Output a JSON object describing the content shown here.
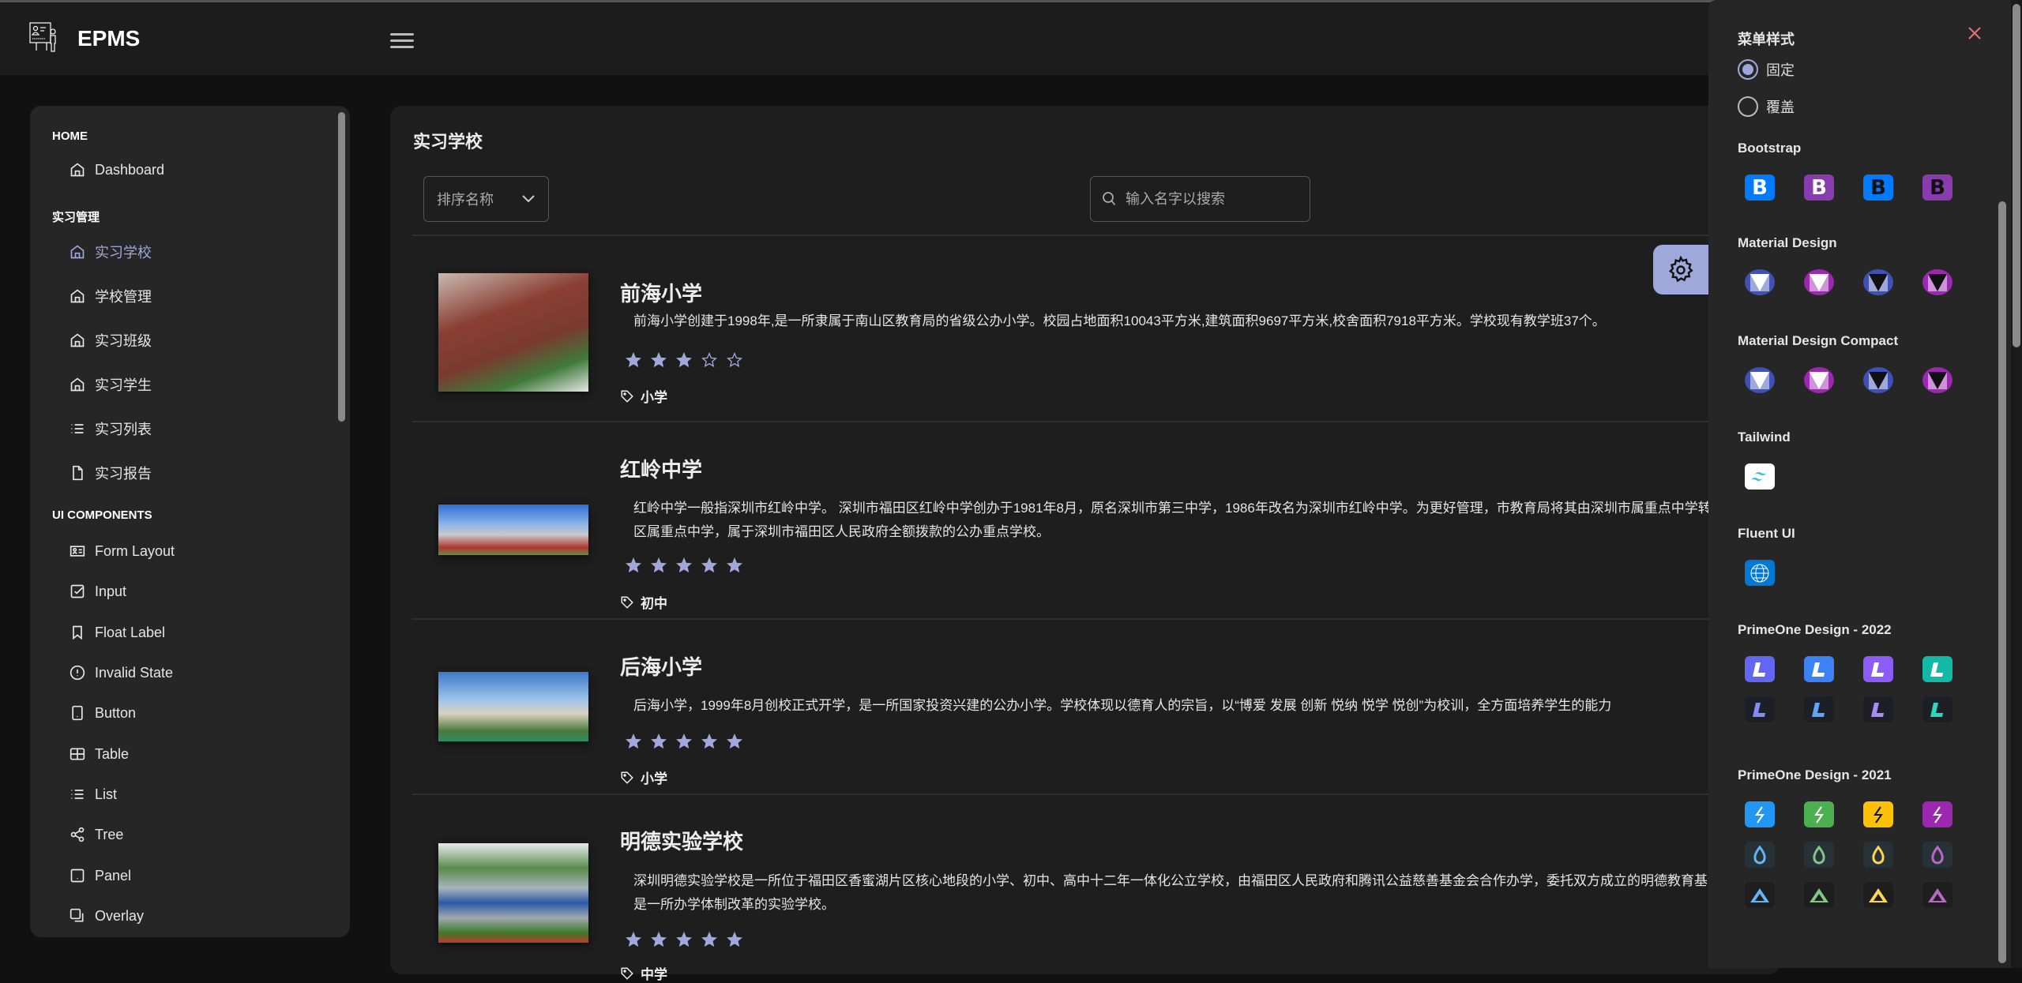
{
  "header": {
    "brand": "EPMS",
    "logo_icon": "teacher-board-icon",
    "menu_icon": "hamburger-icon"
  },
  "sidebar": {
    "sections": [
      {
        "title": "HOME",
        "items": [
          {
            "label": "Dashboard",
            "icon": "home-icon"
          }
        ]
      },
      {
        "title": "实习管理",
        "items": [
          {
            "label": "实习学校",
            "icon": "home-icon",
            "active": true
          },
          {
            "label": "学校管理",
            "icon": "home-icon"
          },
          {
            "label": "实习班级",
            "icon": "home-icon"
          },
          {
            "label": "实习学生",
            "icon": "home-icon"
          },
          {
            "label": "实习列表",
            "icon": "list-icon"
          },
          {
            "label": "实习报告",
            "icon": "file-icon"
          }
        ]
      },
      {
        "title": "UI COMPONENTS",
        "items": [
          {
            "label": "Form Layout",
            "icon": "id-card-icon"
          },
          {
            "label": "Input",
            "icon": "check-square-icon"
          },
          {
            "label": "Float Label",
            "icon": "bookmark-icon"
          },
          {
            "label": "Invalid State",
            "icon": "exclamation-circle-icon"
          },
          {
            "label": "Button",
            "icon": "mobile-icon"
          },
          {
            "label": "Table",
            "icon": "table-icon"
          },
          {
            "label": "List",
            "icon": "list-icon"
          },
          {
            "label": "Tree",
            "icon": "share-icon"
          },
          {
            "label": "Panel",
            "icon": "tablet-icon"
          },
          {
            "label": "Overlay",
            "icon": "clone-icon"
          }
        ]
      }
    ]
  },
  "main": {
    "title": "实习学校",
    "sort_dropdown": {
      "value": "排序名称"
    },
    "search": {
      "placeholder": "输入名字以搜索"
    },
    "schools": [
      {
        "name": "前海小学",
        "description": "前海小学创建于1998年,是一所隶属于南山区教育局的省级公办小学。校园占地面积10043平方米,建筑面积9697平方米,校舍面积7918平方米。学校现有教学班37个。",
        "rating": 3,
        "tag": "小学"
      },
      {
        "name": "红岭中学",
        "description": "红岭中学一般指深圳市红岭中学。 深圳市福田区红岭中学创办于1981年8月，原名深圳市第三中学，1986年改名为深圳市红岭中学。为更好管理，市教育局将其由深圳市属重点中学转变为福田区区属重点中学，属于深圳市福田区人民政府全额拨款的公办重点学校。",
        "rating": 5,
        "tag": "初中"
      },
      {
        "name": "后海小学",
        "description": "后海小学，1999年8月创校正式开学，是一所国家投资兴建的公办小学。学校体现以德育人的宗旨，以“博爱 发展 创新 悦纳 悦学 悦创”为校训，全方面培养学生的能力",
        "rating": 5,
        "tag": "小学"
      },
      {
        "name": "明德实验学校",
        "description": "深圳明德实验学校是一所位于福田区香蜜湖片区核心地段的小学、初中、高中十二年一体化公立学校，由福田区人民政府和腾讯公益慈善基金会合作办学，委托双方成立的明德教育基金会管理，是一所办学体制改革的实验学校。",
        "rating": 5,
        "tag": "中学"
      }
    ],
    "accent": "#9fa8da"
  },
  "config": {
    "menu_type_title": "菜单样式",
    "menu_types": [
      {
        "label": "固定",
        "selected": true
      },
      {
        "label": "覆盖",
        "selected": false
      }
    ],
    "theme_groups": [
      {
        "title": "Bootstrap",
        "rows": [
          [
            {
              "glyph": "B",
              "bg": "#007bff",
              "fg": "#ffffff"
            },
            {
              "glyph": "B",
              "bg": "#883cae",
              "fg": "#ffffff"
            },
            {
              "glyph": "B",
              "bg": "#007bff",
              "fg": "#111111"
            },
            {
              "glyph": "B",
              "bg": "#883cae",
              "fg": "#111111"
            }
          ]
        ]
      },
      {
        "title": "Material Design",
        "rows": [
          [
            {
              "glyph": "md",
              "bg": "#3f51b5",
              "fg": "#ffffff",
              "sq": "#9fa8da"
            },
            {
              "glyph": "md",
              "bg": "#9c27b0",
              "fg": "#ffffff",
              "sq": "#ce93d8"
            },
            {
              "glyph": "md",
              "bg": "#3f51b5",
              "fg": "#111111",
              "sq": "#9fa8da"
            },
            {
              "glyph": "md",
              "bg": "#9c27b0",
              "fg": "#111111",
              "sq": "#ce93d8"
            }
          ]
        ]
      },
      {
        "title": "Material Design Compact",
        "rows": [
          [
            {
              "glyph": "md",
              "bg": "#3f51b5",
              "fg": "#ffffff",
              "sq": "#9fa8da"
            },
            {
              "glyph": "md",
              "bg": "#9c27b0",
              "fg": "#ffffff",
              "sq": "#ce93d8"
            },
            {
              "glyph": "md",
              "bg": "#3f51b5",
              "fg": "#111111",
              "sq": "#9fa8da"
            },
            {
              "glyph": "md",
              "bg": "#9c27b0",
              "fg": "#111111",
              "sq": "#ce93d8"
            }
          ]
        ]
      },
      {
        "title": "Tailwind",
        "rows": [
          [
            {
              "glyph": "tw",
              "bg": "#ffffff",
              "fg": "#38bdf8"
            }
          ]
        ]
      },
      {
        "title": "Fluent UI",
        "rows": [
          [
            {
              "glyph": "globe",
              "bg": "#0078d4",
              "fg": "#ffffff"
            }
          ]
        ]
      },
      {
        "title": "PrimeOne Design - 2022",
        "rows": [
          [
            {
              "glyph": "L",
              "bg": "#6366f1",
              "fg": "#ffffff"
            },
            {
              "glyph": "L",
              "bg": "#3b82f6",
              "fg": "#ffffff"
            },
            {
              "glyph": "L",
              "bg": "#8b5cf6",
              "fg": "#ffffff"
            },
            {
              "glyph": "L",
              "bg": "#14b8a6",
              "fg": "#ffffff"
            }
          ],
          [
            {
              "glyph": "L",
              "bg": "#1c1f26",
              "fg": "#818cf8"
            },
            {
              "glyph": "L",
              "bg": "#1c1f26",
              "fg": "#60a5fa"
            },
            {
              "glyph": "L",
              "bg": "#1c1f26",
              "fg": "#a78bfa"
            },
            {
              "glyph": "L",
              "bg": "#1c1f26",
              "fg": "#2dd4bf"
            }
          ]
        ]
      },
      {
        "title": "PrimeOne Design - 2021",
        "rows": [
          [
            {
              "glyph": "bolt",
              "bg": "#2196f3",
              "fg": "#ffffff"
            },
            {
              "glyph": "bolt",
              "bg": "#4caf50",
              "fg": "#ffffff"
            },
            {
              "glyph": "bolt",
              "bg": "#ffc107",
              "fg": "#111111"
            },
            {
              "glyph": "bolt",
              "bg": "#9c27b0",
              "fg": "#ffffff"
            }
          ],
          [
            {
              "glyph": "flame",
              "bg": "#263238",
              "fg": "#64b5f6"
            },
            {
              "glyph": "flame",
              "bg": "#263238",
              "fg": "#81c784"
            },
            {
              "glyph": "flame",
              "bg": "#263238",
              "fg": "#ffd54f"
            },
            {
              "glyph": "flame",
              "bg": "#263238",
              "fg": "#ba68c8"
            }
          ],
          [
            {
              "glyph": "arya",
              "bg": "#1e1e1e",
              "fg": "#64b5f6"
            },
            {
              "glyph": "arya",
              "bg": "#1e1e1e",
              "fg": "#81c784"
            },
            {
              "glyph": "arya",
              "bg": "#1e1e1e",
              "fg": "#ffd54f"
            },
            {
              "glyph": "arya",
              "bg": "#1e1e1e",
              "fg": "#ba68c8"
            }
          ]
        ]
      }
    ]
  }
}
